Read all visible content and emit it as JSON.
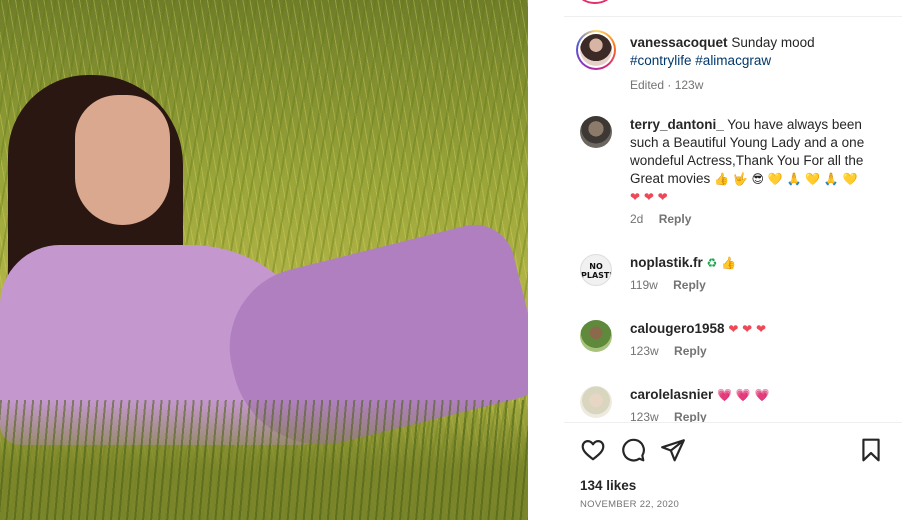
{
  "post": {
    "author": "vanessacoquet",
    "caption": "Sunday mood",
    "hashtags": [
      "#contrylife",
      "#alimacgraw"
    ],
    "edited_label": "Edited",
    "edited_age": "123w"
  },
  "comments": [
    {
      "username": "terry_dantoni_",
      "text": "You have always been such a Beautiful Young Lady and a one wondeful Actress,Thank You For all the Great movies",
      "emojis": [
        "👍",
        "🤟",
        "😎",
        "💛",
        "🙏",
        "💛",
        "🙏",
        "💛",
        "❤",
        "❤",
        "❤"
      ],
      "age": "2d",
      "reply_label": "Reply"
    },
    {
      "username": "noplastik.fr",
      "avatar_text": "NO PLASTIK",
      "text": "",
      "emojis": [
        "♻",
        "👍"
      ],
      "age": "119w",
      "reply_label": "Reply"
    },
    {
      "username": "calougero1958",
      "text": "",
      "emojis": [
        "❤",
        "❤",
        "❤"
      ],
      "age": "123w",
      "reply_label": "Reply"
    },
    {
      "username": "carolelasnier",
      "text": "",
      "emojis": [
        "💗",
        "💗",
        "💗"
      ],
      "age": "123w",
      "reply_label": "Reply"
    }
  ],
  "actions": {
    "like_icon": "heart-outline-icon",
    "comment_icon": "speech-bubble-icon",
    "share_icon": "paper-plane-icon",
    "save_icon": "bookmark-icon"
  },
  "likes_text": "134 likes",
  "date_text": "NOVEMBER 22, 2020",
  "colors": {
    "hashtag": "#00376b",
    "muted": "#737373",
    "heart_red": "#ed4956",
    "story_ring": "#d62976"
  }
}
